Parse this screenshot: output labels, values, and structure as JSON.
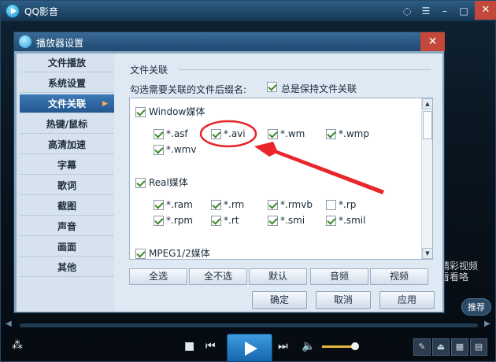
{
  "app": {
    "title": "QQ影音"
  },
  "dialog": {
    "title": "播放器设置",
    "close_glyph": "✕",
    "nav": [
      {
        "label": "文件播放"
      },
      {
        "label": "系统设置"
      },
      {
        "label": "文件关联",
        "active": true
      },
      {
        "label": "热键/鼠标"
      },
      {
        "label": "高清加速"
      },
      {
        "label": "字幕"
      },
      {
        "label": "歌词"
      },
      {
        "label": "截图"
      },
      {
        "label": "声音"
      },
      {
        "label": "画面"
      },
      {
        "label": "其他"
      }
    ],
    "section_title": "文件关联",
    "hint": "勾选需要关联的文件后缀名:",
    "always_keep": {
      "label": "总是保持文件关联",
      "checked": true
    },
    "groups": [
      {
        "label": "Window媒体",
        "checked": true,
        "items": [
          {
            "label": "*.asf",
            "checked": true
          },
          {
            "label": "*.avi",
            "checked": true,
            "highlighted": true
          },
          {
            "label": "*.wm",
            "checked": true
          },
          {
            "label": "*.wmp",
            "checked": true
          },
          {
            "label": "*.wmv",
            "checked": true
          }
        ]
      },
      {
        "label": "Real媒体",
        "checked": true,
        "items": [
          {
            "label": "*.ram",
            "checked": true
          },
          {
            "label": "*.rm",
            "checked": true
          },
          {
            "label": "*.rmvb",
            "checked": true
          },
          {
            "label": "*.rp",
            "checked": false
          },
          {
            "label": "*.rpm",
            "checked": true
          },
          {
            "label": "*.rt",
            "checked": true
          },
          {
            "label": "*.smi",
            "checked": true
          },
          {
            "label": "*.smil",
            "checked": true
          }
        ]
      },
      {
        "label": "MPEG1/2媒体",
        "checked": true,
        "items": []
      }
    ],
    "quick_buttons": [
      "全选",
      "全不选",
      "默认",
      "音频",
      "视频"
    ],
    "footer_buttons": {
      "ok": "确定",
      "cancel": "取消",
      "apply": "应用"
    }
  },
  "player": {
    "recommend": "推荐",
    "promo": "精彩视频\n看看咯"
  },
  "colors": {
    "accent": "#23578f",
    "annotation": "#e8262b",
    "checkmark": "#3d8a2b"
  },
  "icons": [
    "app-logo-icon",
    "skin-icon",
    "minimize-icon",
    "maximize-icon",
    "close-icon",
    "stop-icon",
    "prev-icon",
    "play-icon",
    "next-icon",
    "volume-icon",
    "settings-icon",
    "eject-icon",
    "playlist-icon",
    "fullscreen-icon"
  ]
}
